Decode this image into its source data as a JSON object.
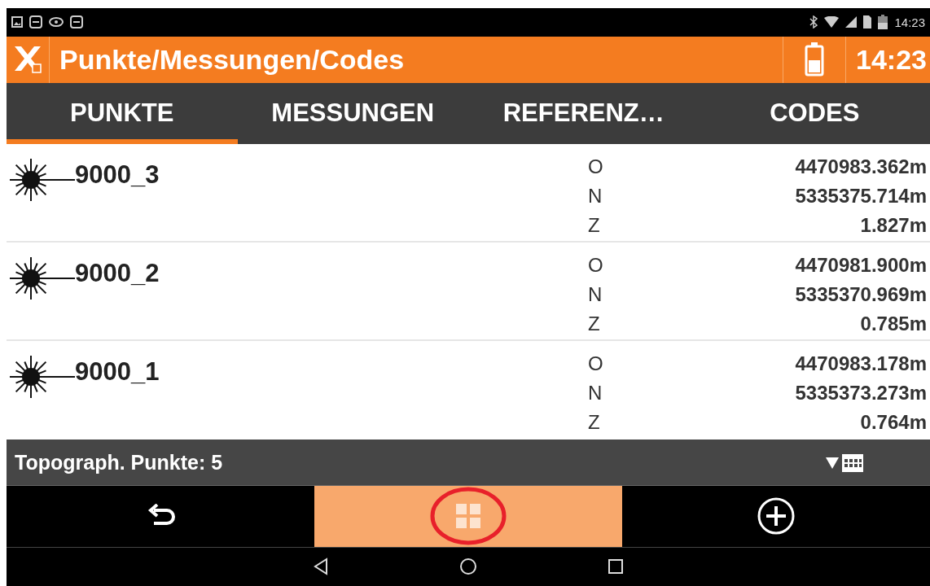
{
  "status_bar": {
    "time": "14:23"
  },
  "app_bar": {
    "title": "Punkte/Messungen/Codes",
    "time": "14:23"
  },
  "tabs": [
    {
      "label": "PUNKTE",
      "selected": true
    },
    {
      "label": "MESSUNGEN",
      "selected": false
    },
    {
      "label": "REFERENZ…",
      "selected": false
    },
    {
      "label": "CODES",
      "selected": false
    }
  ],
  "points": [
    {
      "name": "9000_3",
      "coords": [
        {
          "axis": "O",
          "value": "4470983.362m"
        },
        {
          "axis": "N",
          "value": "5335375.714m"
        },
        {
          "axis": "Z",
          "value": "1.827m"
        }
      ]
    },
    {
      "name": "9000_2",
      "coords": [
        {
          "axis": "O",
          "value": "4470981.900m"
        },
        {
          "axis": "N",
          "value": "5335370.969m"
        },
        {
          "axis": "Z",
          "value": "0.785m"
        }
      ]
    },
    {
      "name": "9000_1",
      "coords": [
        {
          "axis": "O",
          "value": "4470983.178m"
        },
        {
          "axis": "N",
          "value": "5335373.273m"
        },
        {
          "axis": "Z",
          "value": "0.764m"
        }
      ]
    }
  ],
  "footer": {
    "summary": "Topograph. Punkte: 5"
  },
  "toolbar": [
    {
      "kind": "back",
      "selected": false,
      "circled": false
    },
    {
      "kind": "grid",
      "selected": true,
      "circled": true
    },
    {
      "kind": "add",
      "selected": false,
      "circled": false
    }
  ]
}
